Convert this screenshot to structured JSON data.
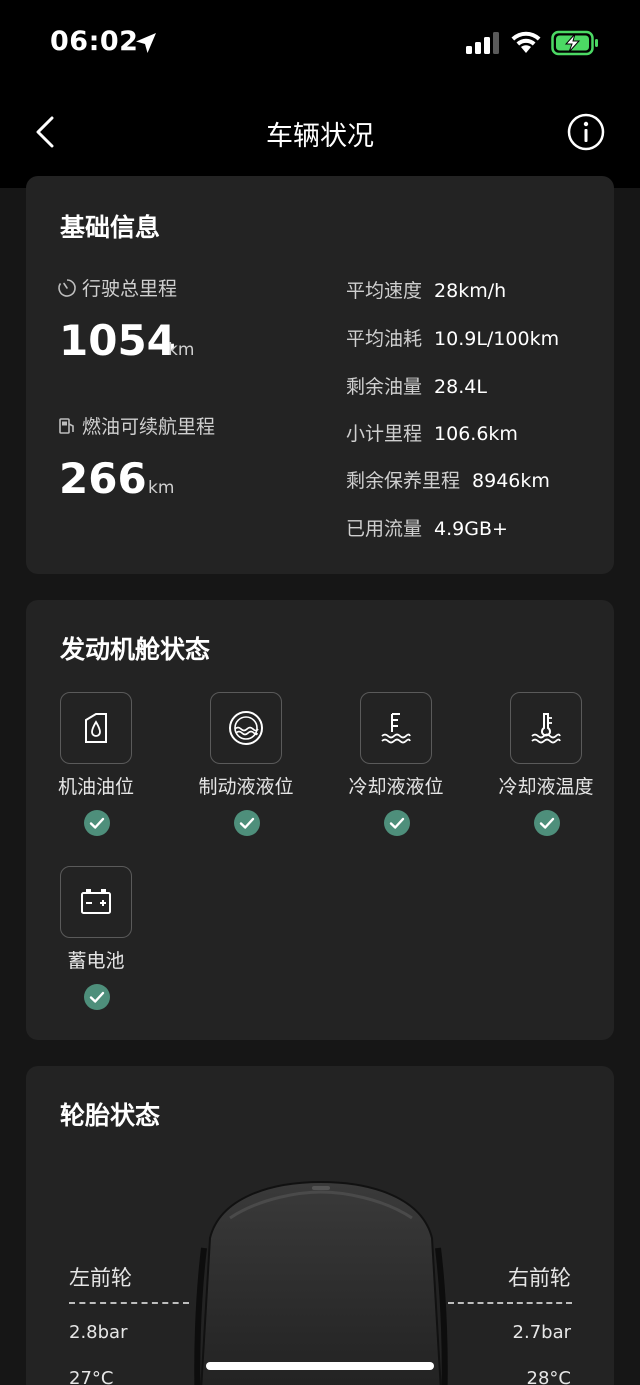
{
  "status_bar": {
    "time": "06:02",
    "icons": [
      "location-arrow-icon",
      "cellular-signal-icon",
      "wifi-icon",
      "battery-charging-icon"
    ],
    "battery_color": "#4cd964"
  },
  "nav": {
    "title": "车辆状况",
    "back_icon": "chevron-left-icon",
    "info_icon": "info-circle-icon"
  },
  "basic_info": {
    "title": "基础信息",
    "total_mileage": {
      "label": "行驶总里程",
      "value": "1054",
      "unit": "km"
    },
    "fuel_range": {
      "label": "燃油可续航里程",
      "value": "266",
      "unit": "km"
    },
    "details": [
      {
        "key": "平均速度",
        "value": "28km/h"
      },
      {
        "key": "平均油耗",
        "value": "10.9L/100km"
      },
      {
        "key": "剩余油量",
        "value": "28.4L"
      },
      {
        "key": "小计里程",
        "value": "106.6km"
      },
      {
        "key": "剩余保养里程",
        "value": "8946km"
      },
      {
        "key": "已用流量",
        "value": "4.9GB+"
      }
    ]
  },
  "engine_status": {
    "title": "发动机舱状态",
    "check_color": "#4e8f7b",
    "items": [
      {
        "label": "机油油位",
        "icon": "oil-can-icon",
        "ok": true
      },
      {
        "label": "制动液液位",
        "icon": "brake-fluid-icon",
        "ok": true
      },
      {
        "label": "冷却液液位",
        "icon": "coolant-level-icon",
        "ok": true
      },
      {
        "label": "冷却液温度",
        "icon": "coolant-temperature-icon",
        "ok": true
      },
      {
        "label": "蓄电池",
        "icon": "battery-icon",
        "ok": true
      }
    ]
  },
  "tire_status": {
    "title": "轮胎状态",
    "front_left": {
      "label": "左前轮",
      "pressure": "2.8bar",
      "temperature": "27°C"
    },
    "front_right": {
      "label": "右前轮",
      "pressure": "2.7bar",
      "temperature": "28°C"
    }
  }
}
